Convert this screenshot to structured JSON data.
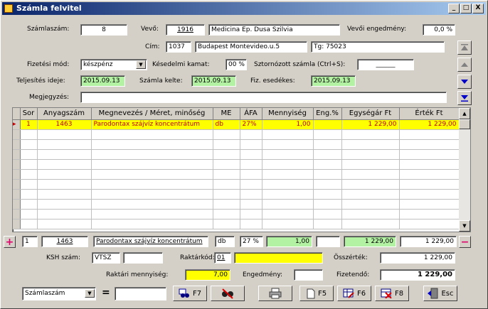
{
  "window": {
    "title": "Számla felvitel",
    "minimize": "_",
    "maximize": "□",
    "close": "X"
  },
  "header": {
    "szamlaszam_label": "Számlaszám:",
    "szamlaszam": "8",
    "vevo_label": "Vevő:",
    "vevo_kod": "1916",
    "vevo_nev": "Medicina Ep. Dusa Szilvia",
    "engedmeny_label": "Vevői engedmény:",
    "engedmeny": "0,0 %",
    "cim_label": "Cím:",
    "irsz": "1037",
    "cim": "Budapest Montevideo.u.5",
    "tg": "Tg: 75023",
    "fizmod_label": "Fizetési mód:",
    "fizmod": "készpénz",
    "kamat_label": "Késedelmi kamat:",
    "kamat": "00 %",
    "sztorno_label": "Sztornózott számla (Ctrl+S):",
    "sztorno": "______",
    "teljesites_label": "Teljesítés ideje:",
    "teljesites": "2015.09.13",
    "kelte_label": "Számla kelte:",
    "kelte": "2015.09.13",
    "esedekes_label": "Fiz. esedékes:",
    "esedekes": "2015.09.13",
    "megjegyzes_label": "Megjegyzés:",
    "megjegyzes": ""
  },
  "grid": {
    "columns": [
      "Sor",
      "Anyagszám",
      "Megnevezés / Méret, minőség",
      "ME",
      "ÁFA",
      "Mennyiség",
      "Eng.%",
      "Egységár Ft",
      "Érték Ft"
    ],
    "rows": [
      {
        "sor": "1",
        "anyagszam": "1463",
        "megnevezes": "Parodontax szájvíz koncentrátum",
        "me": "db",
        "afa": "27%",
        "mennyiseg": "1,00",
        "eng": "",
        "egysegar": "1 229,00",
        "ertek": "1 229,00"
      }
    ]
  },
  "editrow": {
    "plus": "+",
    "minus": "−",
    "sor": "1",
    "anyagszam": "1463",
    "megnevezes": "Parodontax szájvíz koncentrátum",
    "me": "db",
    "afa": "27 %",
    "mennyiseg": "1,00",
    "eng": "",
    "egysegar": "1 229,00",
    "ertek": "1 229,00"
  },
  "footer": {
    "ksh_label": "KSH szám:",
    "ksh": "VTSZ",
    "ksh2": "",
    "raktar_label": "Raktárkód:",
    "raktar": "01",
    "osszertek_label": "Összérték:",
    "osszertek": "1 229,00",
    "raktari_label": "Raktári mennyiség:",
    "raktari": "7,00",
    "engedmeny_label": "Engedmény:",
    "engedmeny": "",
    "fizetendo_label": "Fizetendő:",
    "fizetendo": "1 229,00"
  },
  "toolbar": {
    "search_field": "Számlaszám",
    "equals": "=",
    "search_value": "",
    "f7": "F7",
    "f5": "F5",
    "f6": "F6",
    "f8": "F8",
    "esc": "Esc"
  }
}
